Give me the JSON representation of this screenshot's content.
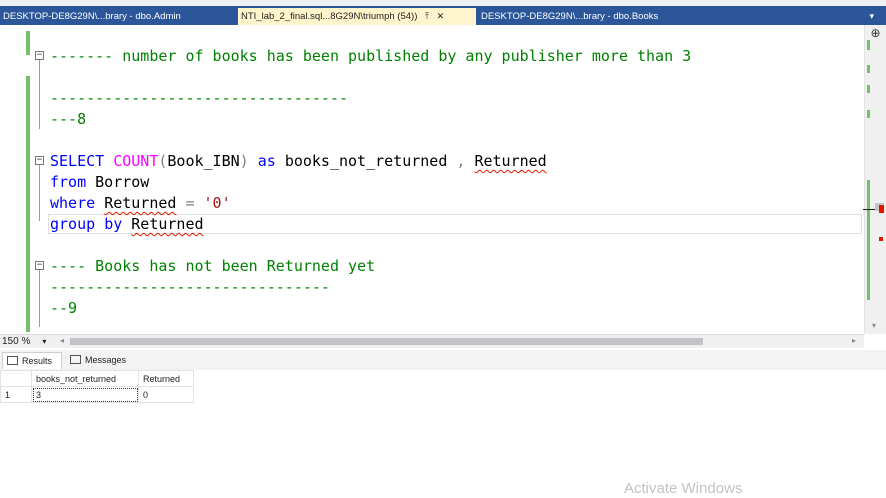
{
  "tabs": [
    {
      "label": "DESKTOP-DE8G29N\\...brary - dbo.Admin",
      "active": false
    },
    {
      "label": "NTI_lab_2_final.sql...8G29N\\triumph (54))",
      "active": true,
      "pin_icon": "pin-icon",
      "close_icon": "close-icon"
    },
    {
      "label": "DESKTOP-DE8G29N\\...brary - dbo.Books",
      "active": false
    }
  ],
  "editor": {
    "comment_publishers": "------- number of books has been published by any publisher more than 3",
    "dashes_1": "---------------------------------",
    "section_8": "---8",
    "sql_select": "SELECT",
    "sql_count": "COUNT",
    "sql_open_paren": "(",
    "sql_book_ibn": "Book_IBN",
    "sql_close_paren": ")",
    "sql_as": "as",
    "sql_alias": "books_not_returned",
    "sql_comma": ",",
    "sql_returned_col": "Returned",
    "sql_from": "from",
    "sql_table": "Borrow",
    "sql_where": "where",
    "sql_returned_where": "Returned",
    "sql_equals": "=",
    "sql_zero": "'0'",
    "sql_group": "group",
    "sql_by": "by",
    "sql_returned_group": "Returned",
    "comment_not_returned": "---- Books has not been Returned yet",
    "dashes_2": "-------------------------------",
    "section_9": "--9"
  },
  "zoom": "150 %",
  "results_tabs": {
    "results": "Results",
    "messages": "Messages"
  },
  "grid": {
    "columns": [
      "books_not_returned",
      "Returned"
    ],
    "rows": [
      {
        "num": "1",
        "cells": [
          "3",
          "0"
        ]
      }
    ]
  },
  "watermark": "Activate Windows",
  "colors": {
    "tabbar": "#2b579a",
    "active_tab": "#fff5cc",
    "comment": "#008000",
    "keyword": "#0000ff",
    "function": "#ff00ff",
    "string": "#a31515"
  }
}
